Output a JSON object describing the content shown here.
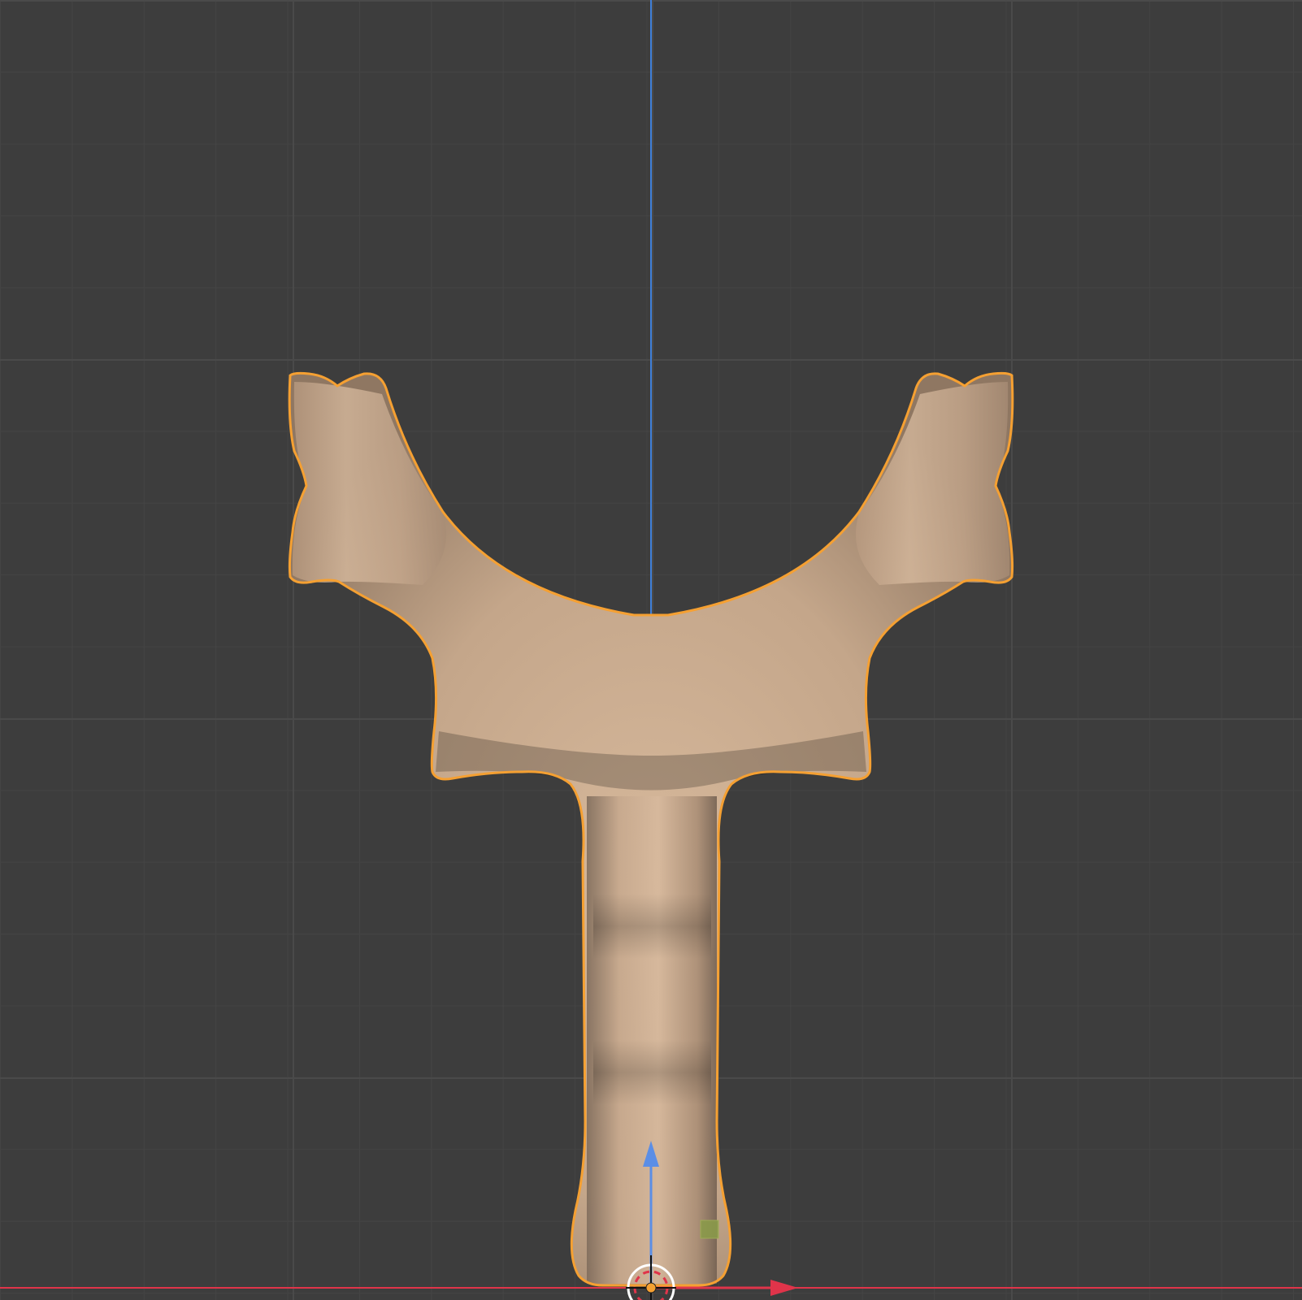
{
  "viewport": {
    "view": "front",
    "colors": {
      "background": "#3d3d3d",
      "grid_minor": "#444444",
      "grid_major": "#4a4a4a",
      "z_axis": "#3f7fd9",
      "x_axis": "#e0344a",
      "selection_outline": "#f5a032",
      "mesh_base": "#c9a688",
      "gizmo_x": "#e0344a",
      "gizmo_z": "#5b8ee6",
      "origin_dot": "#f5a032",
      "marker": "#8a9a4a"
    },
    "selected_object": {
      "shape": "slingshot-fork",
      "selected": true
    },
    "icons": {
      "cursor": "3d-cursor-icon",
      "gizmo": "transform-gizmo-icon"
    }
  }
}
